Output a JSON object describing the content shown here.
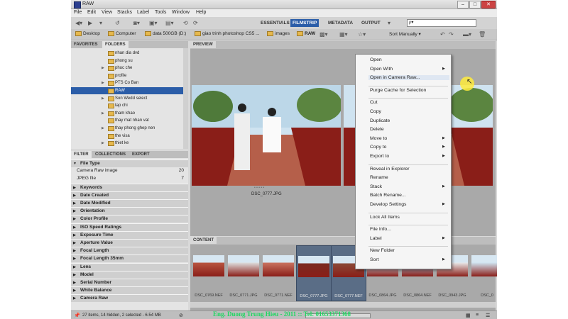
{
  "window": {
    "title": "RAW"
  },
  "menubar": [
    "File",
    "Edit",
    "View",
    "Stacks",
    "Label",
    "Tools",
    "Window",
    "Help"
  ],
  "workspaces": [
    "ESSENTIALS",
    "FILMSTRIP",
    "METADATA",
    "OUTPUT"
  ],
  "active_workspace": "FILMSTRIP",
  "search": {
    "placeholder": "ρ▾"
  },
  "breadcrumb": [
    "Desktop",
    "Computer",
    "data 500GB (D:)",
    "giao trinh photoshop CS5 ...",
    "images",
    "RAW"
  ],
  "sort_label": "Sort Manually",
  "panels": {
    "favorites_tab": "FAVORITES",
    "folders_tab": "FOLDERS",
    "filter_tab": "FILTER",
    "collections_tab": "COLLECTIONS",
    "export_tab": "EXPORT",
    "preview_tab": "PREVIEW",
    "content_tab": "CONTENT"
  },
  "folders": [
    {
      "label": "nhan dia dvd",
      "arrow": ""
    },
    {
      "label": "phong su",
      "arrow": ""
    },
    {
      "label": "phuc che",
      "arrow": "▶"
    },
    {
      "label": "profile",
      "arrow": ""
    },
    {
      "label": "PTS Co Ban",
      "arrow": "▶"
    },
    {
      "label": "RAW",
      "arrow": "",
      "selected": true
    },
    {
      "label": "Son Wedd select",
      "arrow": "▶"
    },
    {
      "label": "tap chi",
      "arrow": ""
    },
    {
      "label": "tham khao",
      "arrow": "▶"
    },
    {
      "label": "thay mat nhan vat",
      "arrow": ""
    },
    {
      "label": "thay phong ghep nen",
      "arrow": "▶"
    },
    {
      "label": "the visa",
      "arrow": ""
    },
    {
      "label": "thiet ke",
      "arrow": "▶"
    }
  ],
  "filters": [
    {
      "label": "File Type",
      "header": true,
      "open": true
    },
    {
      "label": "Camera Raw image",
      "count": "20"
    },
    {
      "label": "JPEG file",
      "count": "7"
    },
    {
      "label": "Keywords",
      "header": true
    },
    {
      "label": "Date Created",
      "header": true
    },
    {
      "label": "Date Modified",
      "header": true
    },
    {
      "label": "Orientation",
      "header": true
    },
    {
      "label": "Color Profile",
      "header": true
    },
    {
      "label": "ISO Speed Ratings",
      "header": true
    },
    {
      "label": "Exposure Time",
      "header": true
    },
    {
      "label": "Aperture Value",
      "header": true
    },
    {
      "label": "Focal Length",
      "header": true
    },
    {
      "label": "Focal Length 35mm",
      "header": true
    },
    {
      "label": "Lens",
      "header": true
    },
    {
      "label": "Model",
      "header": true
    },
    {
      "label": "Serial Number",
      "header": true
    },
    {
      "label": "White Balance",
      "header": true
    },
    {
      "label": "Camera Raw",
      "header": true
    }
  ],
  "preview": {
    "caption": "DSC_0777.JPG",
    "dots": "• • • • •"
  },
  "thumbnails": [
    {
      "name": "DSC_0769.NEF"
    },
    {
      "name": "DSC_0771.JPG"
    },
    {
      "name": "DSC_0771.NEF"
    },
    {
      "name": "DSC_0777.JPG",
      "selected": true
    },
    {
      "name": "DSC_0777.NEF",
      "selected": true
    },
    {
      "name": "DSC_0864.JPG"
    },
    {
      "name": "DSC_0864.NEF"
    },
    {
      "name": "DSC_0943.JPG"
    },
    {
      "name": "DSC_0"
    }
  ],
  "context_menu": [
    {
      "label": "Open"
    },
    {
      "label": "Open With",
      "sub": true
    },
    {
      "label": "Open in Camera Raw...",
      "hover": true
    },
    {
      "sep": true
    },
    {
      "label": "Purge Cache for Selection"
    },
    {
      "sep": true
    },
    {
      "label": "Cut"
    },
    {
      "label": "Copy"
    },
    {
      "label": "Duplicate"
    },
    {
      "label": "Delete"
    },
    {
      "label": "Move to",
      "sub": true
    },
    {
      "label": "Copy to",
      "sub": true
    },
    {
      "label": "Export to",
      "sub": true
    },
    {
      "sep": true
    },
    {
      "label": "Reveal in Explorer"
    },
    {
      "label": "Rename"
    },
    {
      "label": "Stack",
      "sub": true
    },
    {
      "label": "Batch Rename..."
    },
    {
      "label": "Develop Settings",
      "sub": true
    },
    {
      "sep": true
    },
    {
      "label": "Lock All Items"
    },
    {
      "sep": true
    },
    {
      "label": "File Info..."
    },
    {
      "label": "Label",
      "sub": true
    },
    {
      "sep": true
    },
    {
      "label": "New Folder"
    },
    {
      "label": "Sort",
      "sub": true
    }
  ],
  "status": {
    "text": "27 items, 14 hidden, 2 selected - 6.54 MB"
  },
  "credit": "Eng. Duong Trung Hieu - 2011 :: Tel: 01653371368",
  "colors": {
    "selection": "#2b5da8",
    "folder": "#e6b84e",
    "credit": "#1ed760"
  }
}
